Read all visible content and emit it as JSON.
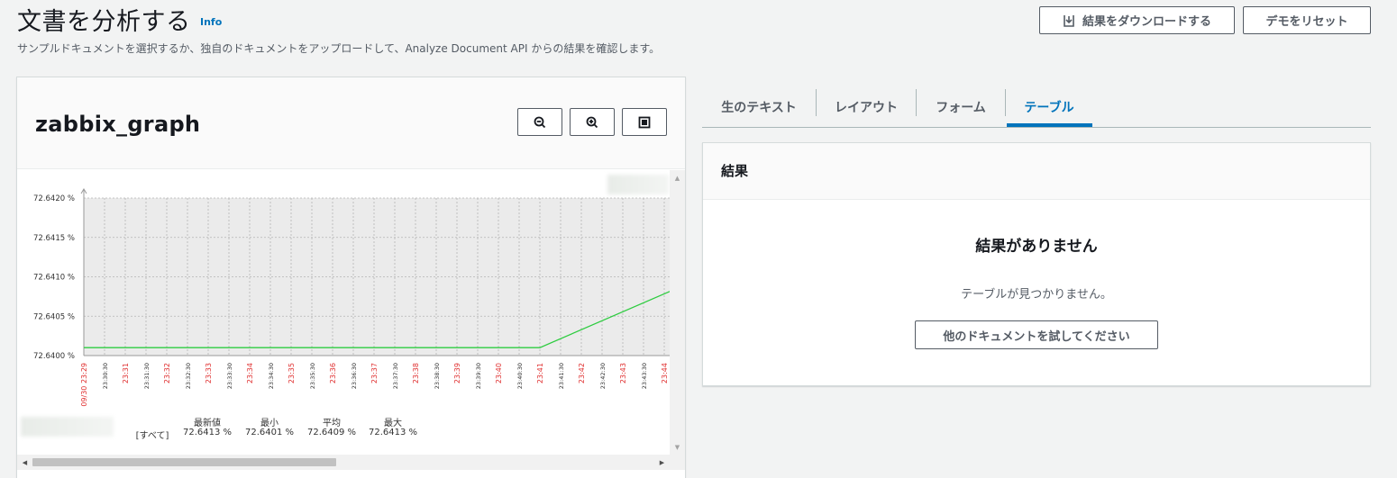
{
  "header": {
    "title": "文書を分析する",
    "info_link": "Info",
    "description": "サンプルドキュメントを選択するか、独自のドキュメントをアップロードして、Analyze Document API からの結果を確認します。",
    "download_button": "結果をダウンロードする",
    "reset_button": "デモをリセット"
  },
  "document": {
    "title": "zabbix_graph",
    "tools": [
      "zoom-out-icon",
      "zoom-in-icon",
      "fit-screen-icon"
    ]
  },
  "chart_data": {
    "type": "line",
    "y_tick_labels": [
      "72.6420 %",
      "72.6415 %",
      "72.6410 %",
      "72.6405 %",
      "72.6400 %"
    ],
    "ylim": [
      72.64,
      72.642
    ],
    "x_tick_labels": [
      "09/30 23:29",
      "23:30:30",
      "23:31",
      "23:31:30",
      "23:32",
      "23:32:30",
      "23:33",
      "23:33:30",
      "23:34",
      "23:34:30",
      "23:35",
      "23:35:30",
      "23:36",
      "23:36:30",
      "23:37",
      "23:37:30",
      "23:38",
      "23:38:30",
      "23:39",
      "23:39:30",
      "23:40",
      "23:40:30",
      "23:41",
      "23:41:30",
      "23:42",
      "23:42:30",
      "23:43",
      "23:43:30",
      "23:44"
    ],
    "series": [
      {
        "color": "#2ecc40",
        "x": [
          "23:29",
          "23:40",
          "23:44:10"
        ],
        "y": [
          72.6401,
          72.6401,
          72.64105
        ]
      }
    ],
    "grid": true,
    "legend": {
      "scope": "[すべて]",
      "columns": [
        {
          "label": "最新値",
          "value": "72.6413 %"
        },
        {
          "label": "最小",
          "value": "72.6401 %"
        },
        {
          "label": "平均",
          "value": "72.6409 %"
        },
        {
          "label": "最大",
          "value": "72.6413 %"
        }
      ]
    }
  },
  "tabs": [
    {
      "label": "生のテキスト",
      "active": false
    },
    {
      "label": "レイアウト",
      "active": false
    },
    {
      "label": "フォーム",
      "active": false
    },
    {
      "label": "テーブル",
      "active": true
    }
  ],
  "results": {
    "title": "結果",
    "empty_title": "結果がありません",
    "empty_desc": "テーブルが見つかりません。",
    "try_button": "他のドキュメントを試してください"
  },
  "colors": {
    "accent": "#0073bb",
    "series": "#2ecc40",
    "tick_major": "#e03030",
    "tick_minor": "#333333"
  }
}
